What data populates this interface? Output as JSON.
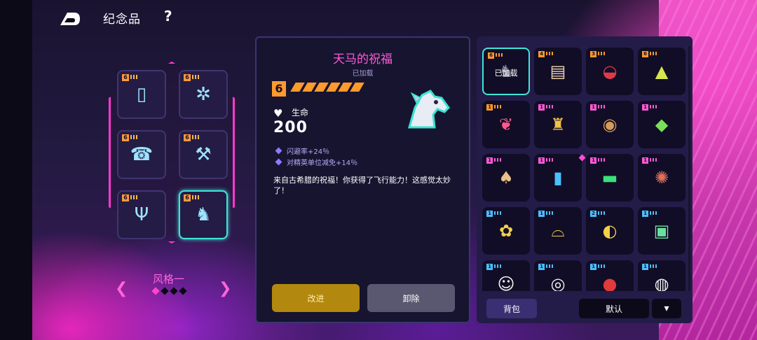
{
  "header": {
    "title": "纪念品",
    "help_label": "?"
  },
  "colors": {
    "accent_pink": "#ff5ad6",
    "equipped_cyan": "#3fe6d8",
    "tier_orange": "#ff9a2c",
    "upgrade_gold": "#b3880e"
  },
  "slots": [
    {
      "tier": "6",
      "icon": "phone-icon",
      "glyph": "▯",
      "selected": false
    },
    {
      "tier": "6",
      "icon": "molecule-icon",
      "glyph": "✲",
      "selected": false
    },
    {
      "tier": "6",
      "icon": "telephone-icon",
      "glyph": "☎",
      "selected": false
    },
    {
      "tier": "6",
      "icon": "wrench-icon",
      "glyph": "⚒",
      "selected": false
    },
    {
      "tier": "6",
      "icon": "tuning-fork-icon",
      "glyph": "Ψ",
      "selected": false
    },
    {
      "tier": "6",
      "icon": "pegasus-icon",
      "glyph": "♞",
      "selected": true
    }
  ],
  "style_selector": {
    "label": "风格一",
    "prev": "❮",
    "next": "❯",
    "pages": 4,
    "active_page": 1
  },
  "detail": {
    "name": "天马的祝福",
    "status": "已加载",
    "tier": "6",
    "stars": 6,
    "icon": "pegasus-icon",
    "stat_label": "生命",
    "stat_value": "200",
    "bonuses": [
      "闪避率+24％",
      "对精英单位减免+14％"
    ],
    "description": "来自古希腊的祝福！你获得了飞行能力！这感觉太妙了！",
    "upgrade_label": "改进",
    "remove_label": "卸除"
  },
  "inventory": {
    "equipped_label": "已加载",
    "items": [
      {
        "tier": "6",
        "tier_color": "#ff9a2c",
        "icon": "pegasus-icon",
        "glyph": "♞",
        "glyph_color": "#888a9a",
        "equipped": true,
        "new": false
      },
      {
        "tier": "4",
        "tier_color": "#ff9a2c",
        "icon": "scroll-icon",
        "glyph": "▤",
        "glyph_color": "#f2d6b0",
        "equipped": false,
        "new": false
      },
      {
        "tier": "3",
        "tier_color": "#ff9a2c",
        "icon": "cap-icon",
        "glyph": "◒",
        "glyph_color": "#e03a4a",
        "equipped": false,
        "new": false
      },
      {
        "tier": "6",
        "tier_color": "#ff9a2c",
        "icon": "pyramid-icon",
        "glyph": "▲",
        "glyph_color": "#d6e64a",
        "equipped": false,
        "new": false
      },
      {
        "tier": "1",
        "tier_color": "#ff9a2c",
        "icon": "raspberry-icon",
        "glyph": "❦",
        "glyph_color": "#ff5a8a",
        "equipped": false,
        "new": false
      },
      {
        "tier": "1",
        "tier_color": "#ff5ad6",
        "icon": "golden-trophy-icon",
        "glyph": "♜",
        "glyph_color": "#f2c24a",
        "equipped": false,
        "new": false
      },
      {
        "tier": "1",
        "tier_color": "#ff5ad6",
        "icon": "owl-icon",
        "glyph": "◉",
        "glyph_color": "#d69a5a",
        "equipped": false,
        "new": false
      },
      {
        "tier": "1",
        "tier_color": "#ff5ad6",
        "icon": "crystal-icon",
        "glyph": "◆",
        "glyph_color": "#7ae05a",
        "equipped": false,
        "new": false
      },
      {
        "tier": "1",
        "tier_color": "#ff5ad6",
        "icon": "mushroom-icon",
        "glyph": "♠",
        "glyph_color": "#e8c08a",
        "equipped": false,
        "new": false
      },
      {
        "tier": "1",
        "tier_color": "#ff5ad6",
        "icon": "game-console-icon",
        "glyph": "▮",
        "glyph_color": "#4ac0ff",
        "equipped": false,
        "new": true
      },
      {
        "tier": "1",
        "tier_color": "#ff5ad6",
        "icon": "green-chip-icon",
        "glyph": "▬",
        "glyph_color": "#3ae07a",
        "equipped": false,
        "new": false
      },
      {
        "tier": "1",
        "tier_color": "#ff5ad6",
        "icon": "beetle-icon",
        "glyph": "✺",
        "glyph_color": "#e0705a",
        "equipped": false,
        "new": false
      },
      {
        "tier": "1",
        "tier_color": "#4ac0ff",
        "icon": "flower-icon",
        "glyph": "✿",
        "glyph_color": "#f2d04a",
        "equipped": false,
        "new": false
      },
      {
        "tier": "1",
        "tier_color": "#4ac0ff",
        "icon": "headband-icon",
        "glyph": "⌓",
        "glyph_color": "#f2d04a",
        "equipped": false,
        "new": false
      },
      {
        "tier": "2",
        "tier_color": "#4ac0ff",
        "icon": "helmet-icon",
        "glyph": "◐",
        "glyph_color": "#f2d04a",
        "equipped": false,
        "new": false
      },
      {
        "tier": "1",
        "tier_color": "#4ac0ff",
        "icon": "portal-icon",
        "glyph": "▣",
        "glyph_color": "#6ae0a0",
        "equipped": false,
        "new": false
      },
      {
        "tier": "1",
        "tier_color": "#4ac0ff",
        "icon": "lucky-cat-icon",
        "glyph": "☺",
        "glyph_color": "#f2f2f2",
        "equipped": false,
        "new": false
      },
      {
        "tier": "1",
        "tier_color": "#4ac0ff",
        "icon": "eye-icon",
        "glyph": "◎",
        "glyph_color": "#f2f2f2",
        "equipped": false,
        "new": false
      },
      {
        "tier": "1",
        "tier_color": "#4ac0ff",
        "icon": "spider-mask-icon",
        "glyph": "●",
        "glyph_color": "#e03a3a",
        "equipped": false,
        "new": false
      },
      {
        "tier": "1",
        "tier_color": "#4ac0ff",
        "icon": "astronaut-icon",
        "glyph": "◍",
        "glyph_color": "#f2f2f2",
        "equipped": false,
        "new": false
      }
    ],
    "bag_label": "背包",
    "default_label": "默认",
    "sort_label": "▾"
  }
}
